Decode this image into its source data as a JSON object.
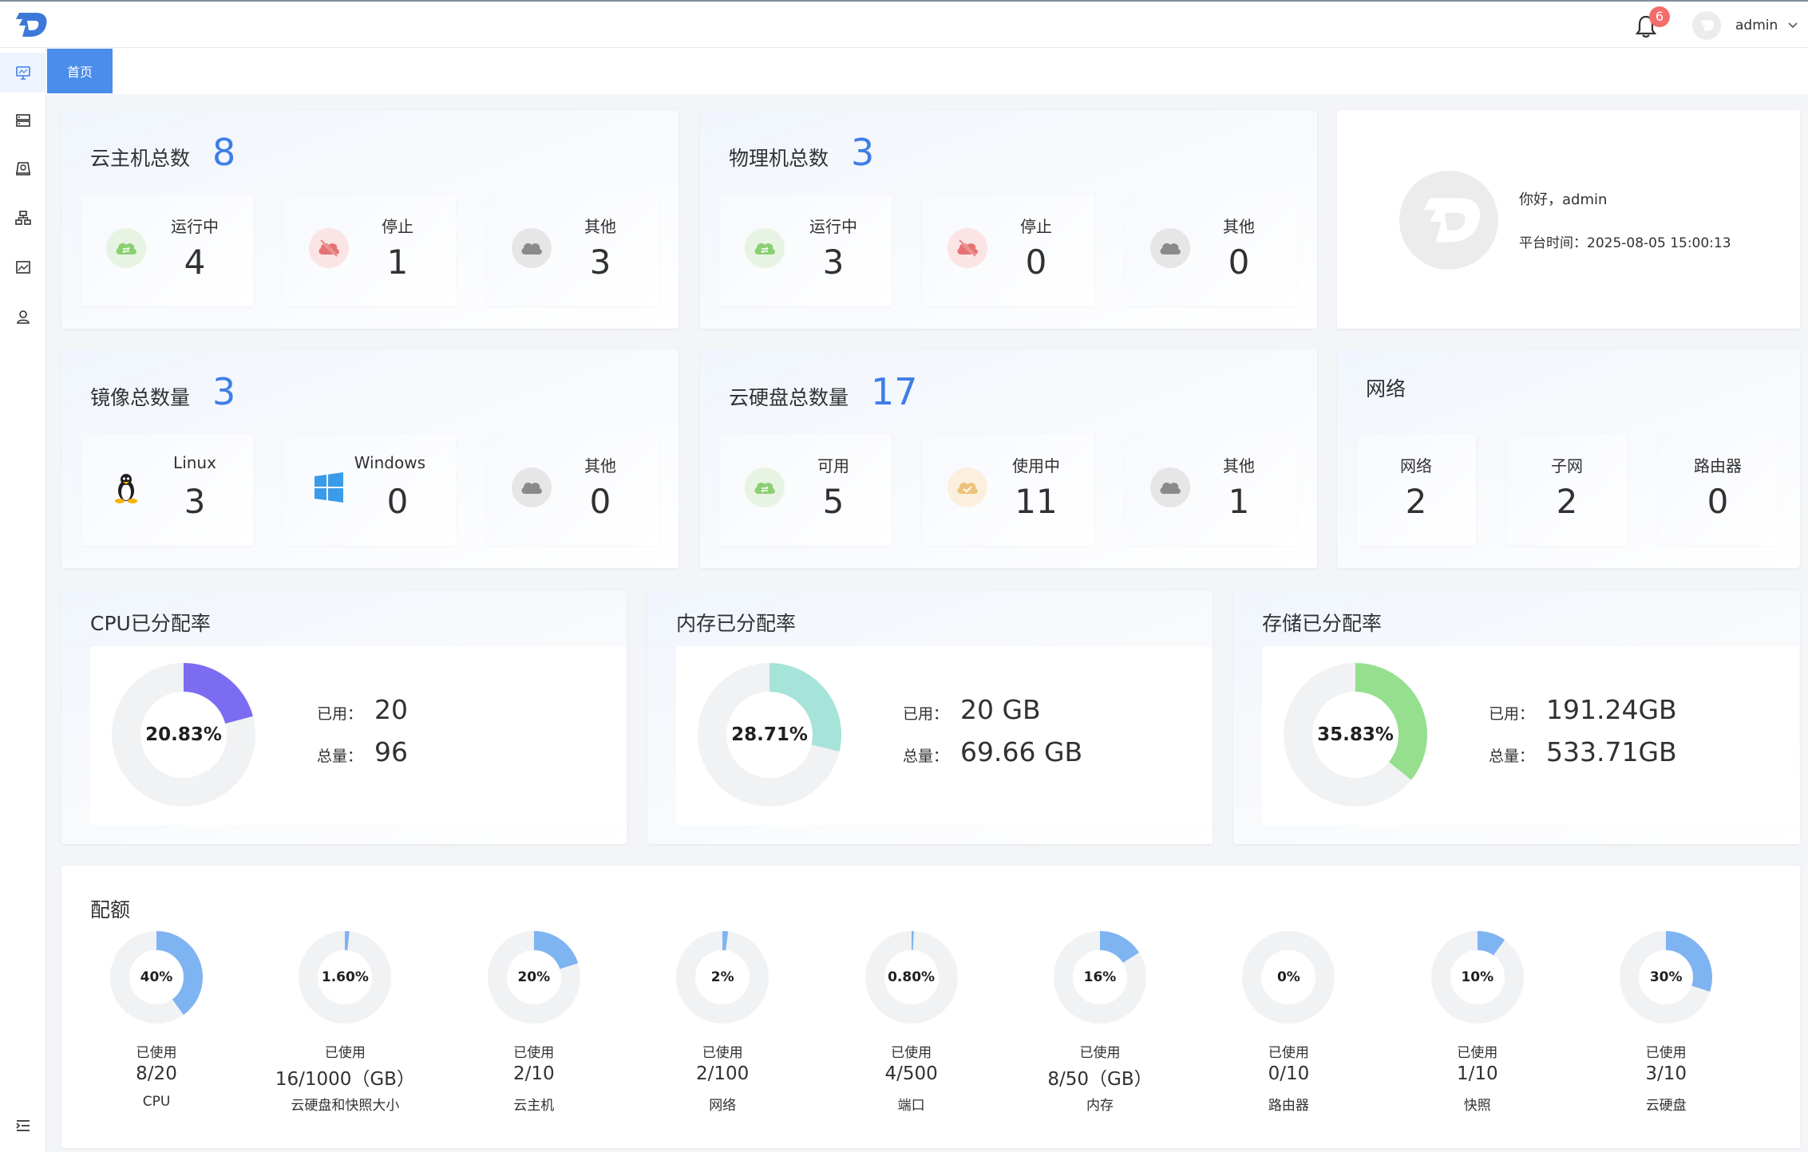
{
  "header": {
    "notification_count": "6",
    "username": "admin"
  },
  "sidebar": {
    "items": [
      {
        "icon": "monitor-icon"
      },
      {
        "icon": "server-icon"
      },
      {
        "icon": "disk-icon"
      },
      {
        "icon": "network-icon"
      },
      {
        "icon": "image-icon"
      },
      {
        "icon": "user-icon"
      }
    ],
    "collapse_icon": "menu-fold-icon"
  },
  "tabs": [
    {
      "label": "首页"
    }
  ],
  "vm": {
    "title": "云主机总数",
    "total": "8",
    "items": [
      {
        "label": "运行中",
        "value": "4",
        "icon": "cloud-running-icon"
      },
      {
        "label": "停止",
        "value": "1",
        "icon": "cloud-stopped-icon"
      },
      {
        "label": "其他",
        "value": "3",
        "icon": "cloud-other-icon"
      }
    ]
  },
  "physical": {
    "title": "物理机总数",
    "total": "3",
    "items": [
      {
        "label": "运行中",
        "value": "3",
        "icon": "cloud-running-icon"
      },
      {
        "label": "停止",
        "value": "0",
        "icon": "cloud-stopped-icon"
      },
      {
        "label": "其他",
        "value": "0",
        "icon": "cloud-other-icon"
      }
    ]
  },
  "welcome": {
    "greeting": "你好，admin",
    "platform_time": "平台时间：2025-08-05 15:00:13"
  },
  "images": {
    "title": "镜像总数量",
    "total": "3",
    "items": [
      {
        "label": "Linux",
        "value": "3",
        "icon": "linux-icon"
      },
      {
        "label": "Windows",
        "value": "0",
        "icon": "windows-icon"
      },
      {
        "label": "其他",
        "value": "0",
        "icon": "cloud-other-icon"
      }
    ]
  },
  "disks": {
    "title": "云硬盘总数量",
    "total": "17",
    "items": [
      {
        "label": "可用",
        "value": "5",
        "icon": "cloud-available-icon"
      },
      {
        "label": "使用中",
        "value": "11",
        "icon": "cloud-in-use-icon"
      },
      {
        "label": "其他",
        "value": "1",
        "icon": "cloud-other-icon"
      }
    ]
  },
  "network": {
    "title": "网络",
    "items": [
      {
        "label": "网络",
        "value": "2"
      },
      {
        "label": "子网",
        "value": "2"
      },
      {
        "label": "路由器",
        "value": "0"
      }
    ]
  },
  "allocation": [
    {
      "title": "CPU已分配率",
      "percent_label": "20.83%",
      "ratio": 0.2083,
      "color": "#7b6cf2",
      "used_label": "已用：",
      "used": "20",
      "total_label": "总量：",
      "total": "96"
    },
    {
      "title": "内存已分配率",
      "percent_label": "28.71%",
      "ratio": 0.2871,
      "color": "#a6e3d8",
      "used_label": "已用：",
      "used": "20 GB",
      "total_label": "总量：",
      "total": "69.66 GB"
    },
    {
      "title": "存储已分配率",
      "percent_label": "35.83%",
      "ratio": 0.3583,
      "color": "#95df8e",
      "used_label": "已用：",
      "used": "191.24GB",
      "total_label": "总量：",
      "total": "533.71GB"
    }
  ],
  "quota": {
    "title": "配额",
    "used_label": "已使用",
    "color": "#7fb4f2",
    "items": [
      {
        "percent_label": "40%",
        "ratio": 0.4,
        "value": "8/20",
        "name": "CPU"
      },
      {
        "percent_label": "1.60%",
        "ratio": 0.016,
        "value": "16/1000（GB）",
        "name": "云硬盘和快照大小"
      },
      {
        "percent_label": "20%",
        "ratio": 0.2,
        "value": "2/10",
        "name": "云主机"
      },
      {
        "percent_label": "2%",
        "ratio": 0.02,
        "value": "2/100",
        "name": "网络"
      },
      {
        "percent_label": "0.80%",
        "ratio": 0.008,
        "value": "4/500",
        "name": "端口"
      },
      {
        "percent_label": "16%",
        "ratio": 0.16,
        "value": "8/50（GB）",
        "name": "内存"
      },
      {
        "percent_label": "0%",
        "ratio": 0.0,
        "value": "0/10",
        "name": "路由器"
      },
      {
        "percent_label": "10%",
        "ratio": 0.1,
        "value": "1/10",
        "name": "快照"
      },
      {
        "percent_label": "30%",
        "ratio": 0.3,
        "value": "3/10",
        "name": "云硬盘"
      }
    ]
  }
}
